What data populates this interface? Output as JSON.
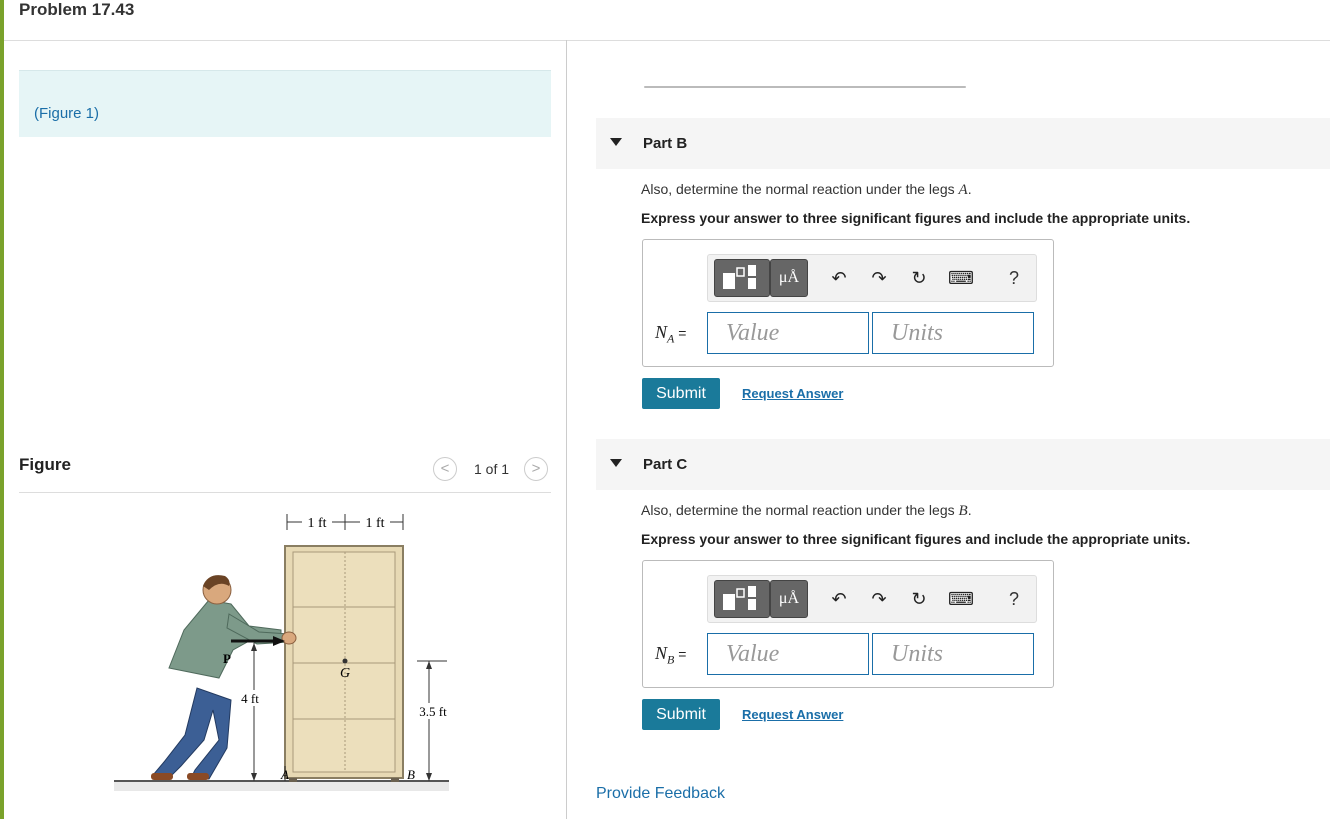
{
  "problem_title": "Problem 17.43",
  "figure_link": "(Figure 1)",
  "figure_panel": {
    "title": "Figure",
    "pager": "1 of 1",
    "prev": "<",
    "next": ">",
    "labels": {
      "dim_top_left": "1 ft",
      "dim_top_right": "1 ft",
      "P": "P",
      "G": "G",
      "h_left": "4 ft",
      "h_right": "3.5 ft",
      "A": "A",
      "B": "B"
    }
  },
  "parts": [
    {
      "label": "Part B",
      "question_prefix": "Also, determine the normal reaction under the legs ",
      "question_var": "A",
      "question_suffix": ".",
      "instruction": "Express your answer to three significant figures and include the appropriate units.",
      "var_name": "N",
      "var_sub": "A",
      "equals": " =",
      "value_placeholder": "Value",
      "units_placeholder": "Units",
      "submit": "Submit",
      "request": "Request Answer"
    },
    {
      "label": "Part C",
      "question_prefix": "Also, determine the normal reaction under the legs ",
      "question_var": "B",
      "question_suffix": ".",
      "instruction": "Express your answer to three significant figures and include the appropriate units.",
      "var_name": "N",
      "var_sub": "B",
      "equals": " =",
      "value_placeholder": "Value",
      "units_placeholder": "Units",
      "submit": "Submit",
      "request": "Request Answer"
    }
  ],
  "toolbar": {
    "units_symbol": "μÅ",
    "undo": "↶",
    "redo": "↷",
    "reset": "↻",
    "keyboard": "⌨",
    "help": "?"
  },
  "feedback": "Provide Feedback"
}
